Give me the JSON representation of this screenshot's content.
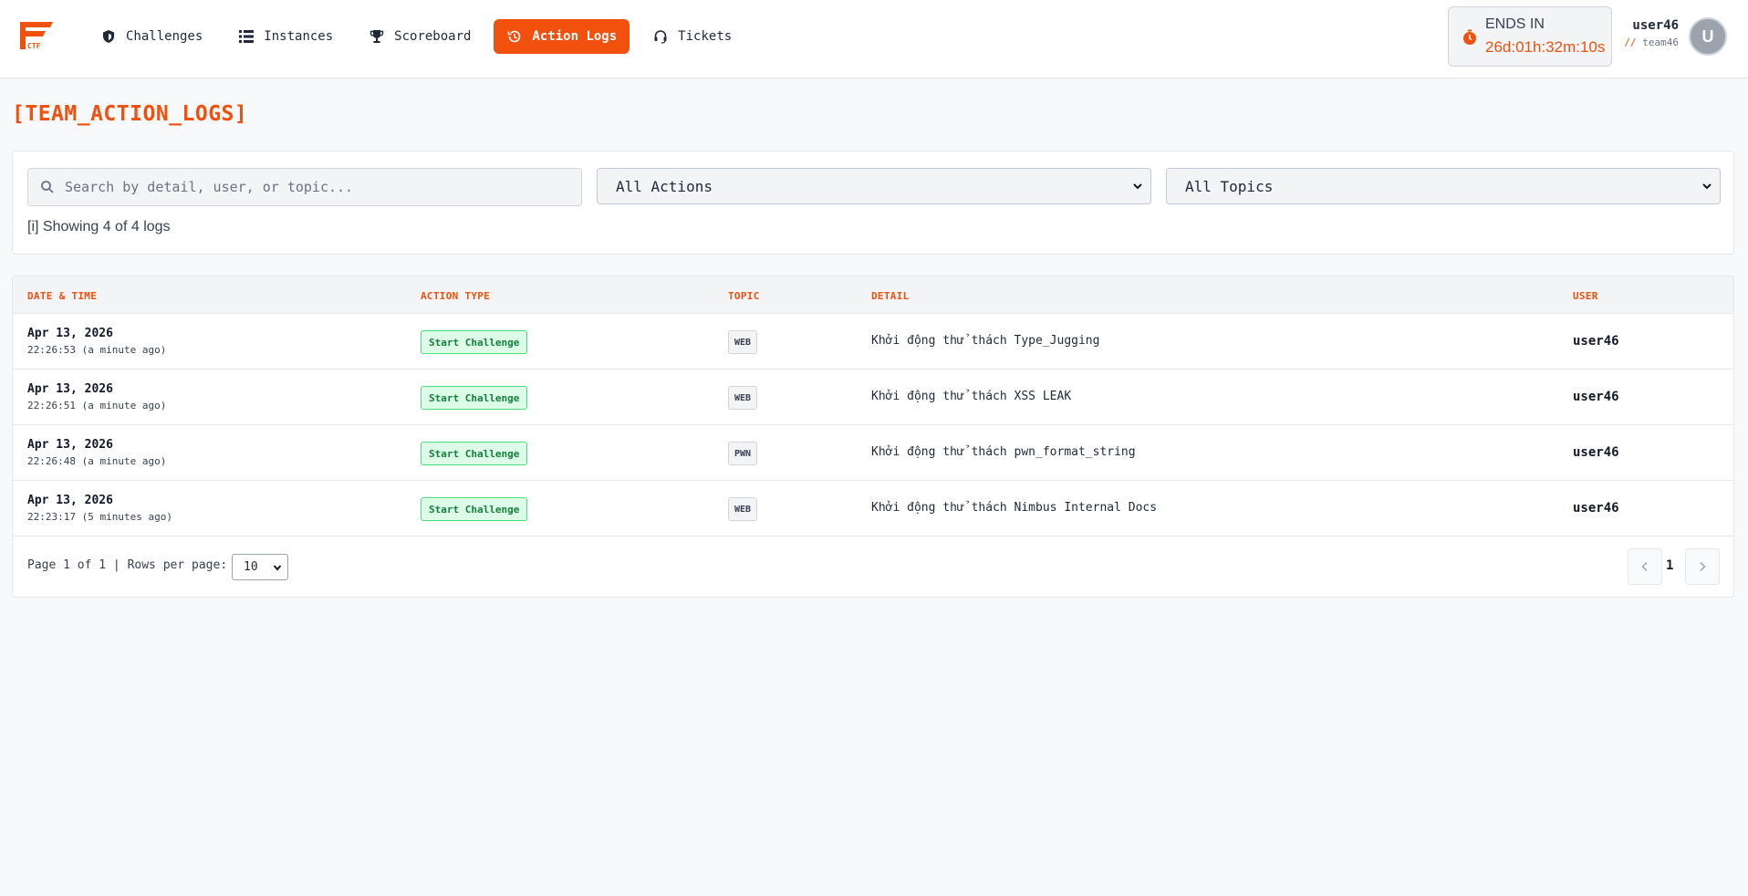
{
  "nav": {
    "logo_text": "CTF",
    "items": [
      {
        "label": "Challenges",
        "icon": "shield-icon"
      },
      {
        "label": "Instances",
        "icon": "list-icon"
      },
      {
        "label": "Scoreboard",
        "icon": "trophy-icon"
      },
      {
        "label": "Action Logs",
        "icon": "history-icon",
        "active": true
      },
      {
        "label": "Tickets",
        "icon": "headset-icon"
      }
    ]
  },
  "timer": {
    "label": "ENDS IN",
    "value": "26d:01h:32m:10s"
  },
  "user": {
    "name": "user46",
    "team_prefix": "//",
    "team": "team46",
    "avatar_initial": "U"
  },
  "page": {
    "title": "[TEAM_ACTION_LOGS]"
  },
  "filters": {
    "search_placeholder": "Search by detail, user, or topic...",
    "action_select": "All Actions",
    "topic_select": "All Topics",
    "showing": "[i] Showing 4 of 4 logs"
  },
  "table": {
    "headers": {
      "datetime": "DATE & TIME",
      "action": "ACTION TYPE",
      "topic": "TOPIC",
      "detail": "DETAIL",
      "user": "USER"
    },
    "rows": [
      {
        "date": "Apr 13, 2026",
        "time": "22:26:53 (a minute ago)",
        "action": "Start Challenge",
        "topic": "WEB",
        "detail": "Khởi động thử thách Type_Jugging",
        "user": "user46"
      },
      {
        "date": "Apr 13, 2026",
        "time": "22:26:51 (a minute ago)",
        "action": "Start Challenge",
        "topic": "WEB",
        "detail": "Khởi động thử thách XSS LEAK",
        "user": "user46"
      },
      {
        "date": "Apr 13, 2026",
        "time": "22:26:48 (a minute ago)",
        "action": "Start Challenge",
        "topic": "PWN",
        "detail": "Khởi động thử thách pwn_format_string",
        "user": "user46"
      },
      {
        "date": "Apr 13, 2026",
        "time": "22:23:17 (5 minutes ago)",
        "action": "Start Challenge",
        "topic": "WEB",
        "detail": "Khởi động thử thách Nimbus Internal Docs",
        "user": "user46"
      }
    ]
  },
  "pagination": {
    "info": "Page 1 of 1 | Rows per page:",
    "rows_per_page": "10",
    "current_page": "1"
  },
  "colors": {
    "accent": "#f2500d",
    "success": "#15803d"
  }
}
